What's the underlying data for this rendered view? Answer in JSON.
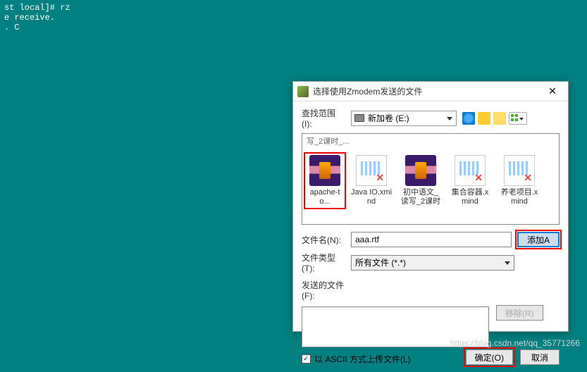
{
  "terminal": {
    "line1": "st local]# rz",
    "line2": "e receive.",
    "line3": ". C"
  },
  "dialog": {
    "title": "选择使用Zmodem发送的文件",
    "scope_label": "查找范围(I):",
    "scope_value": "新加卷 (E:)",
    "cutoff_items": [
      "写_2课时_...",
      "",
      "",
      "",
      ""
    ],
    "files": [
      {
        "name": "apache-to...",
        "type": "rar",
        "highlight": true
      },
      {
        "name": "Java IO.xmind",
        "type": "xmind"
      },
      {
        "name": "初中语文_读写_2课时_...",
        "type": "rar"
      },
      {
        "name": "集合容器.xmind",
        "type": "xmind"
      },
      {
        "name": "养老项目.xmind",
        "type": "xmind"
      }
    ],
    "filename_label": "文件名(N):",
    "filename_value": "aaa.rtf",
    "add_label": "添加A",
    "filetype_label": "文件类型(T):",
    "filetype_value": "所有文件 (*.*)",
    "sendfiles_label": "发送的文件(F):",
    "remove_label": "移除(R)",
    "ascii_label": "以 ASCII 方式上传文件(L)",
    "ascii_checked": true,
    "ok_label": "确定(O)",
    "cancel_label": "取消"
  },
  "watermark": "https://blog.csdn.net/qq_35771266"
}
